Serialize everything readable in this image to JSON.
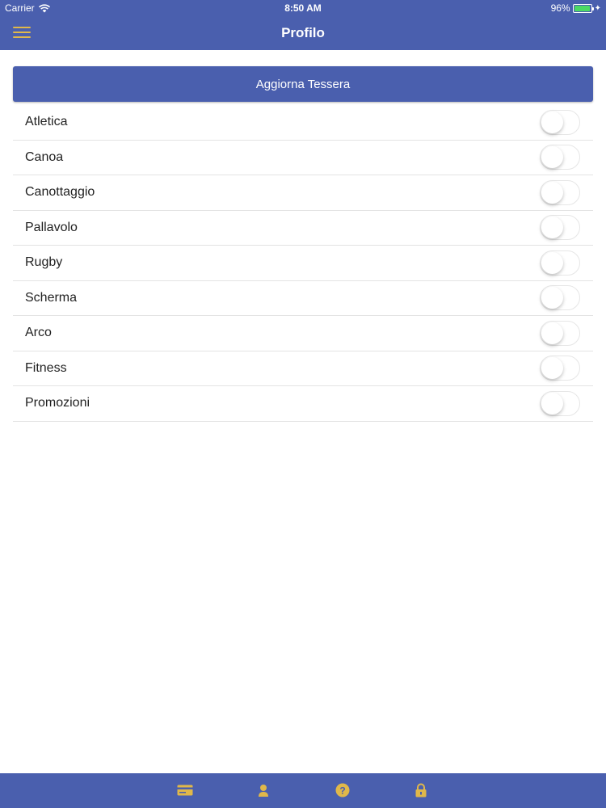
{
  "status_bar": {
    "carrier": "Carrier",
    "time": "8:50 AM",
    "battery": "96%",
    "battery_level": 0.96
  },
  "nav": {
    "title": "Profilo",
    "menu_icon": "hamburger-menu-icon"
  },
  "actions": {
    "update_label": "Aggiorna Tessera"
  },
  "preferences": [
    {
      "label": "Atletica",
      "enabled": false
    },
    {
      "label": "Canoa",
      "enabled": false
    },
    {
      "label": "Canottaggio",
      "enabled": false
    },
    {
      "label": "Pallavolo",
      "enabled": false
    },
    {
      "label": "Rugby",
      "enabled": false
    },
    {
      "label": "Scherma",
      "enabled": false
    },
    {
      "label": "Arco",
      "enabled": false
    },
    {
      "label": "Fitness",
      "enabled": false
    },
    {
      "label": "Promozioni",
      "enabled": false
    }
  ],
  "tab_bar": {
    "icons": [
      "card-icon",
      "user-icon",
      "help-icon",
      "lock-icon"
    ]
  },
  "colors": {
    "primary": "#4a5fae",
    "accent": "#e0b84a",
    "battery": "#4cd964"
  }
}
